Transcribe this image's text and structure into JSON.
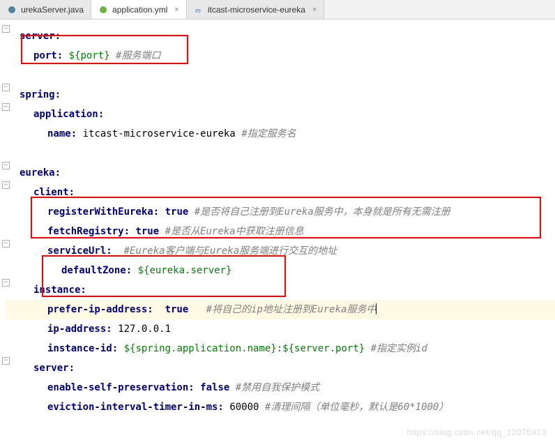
{
  "tabs": [
    {
      "label": "urekaServer.java",
      "icon": "java",
      "active": false,
      "closable": false
    },
    {
      "label": "application.yml",
      "icon": "spring",
      "active": true,
      "closable": true
    },
    {
      "label": "itcast-microservice-eureka",
      "icon": "maven",
      "active": false,
      "closable": true
    }
  ],
  "code": {
    "server": "server:",
    "port_key": "port:",
    "port_val": "${port}",
    "port_comment": "#服务端口",
    "spring": "spring:",
    "application": "application:",
    "name_key": "name:",
    "name_val": "itcast-microservice-eureka",
    "name_comment": "#指定服务名",
    "eureka": "eureka:",
    "client": "client:",
    "registerWithEureka_key": "registerWithEureka:",
    "registerWithEureka_val": "true",
    "registerWithEureka_comment": "#是否将自己注册到Eureka服务中，本身就是所有无需注册",
    "fetchRegistry_key": "fetchRegistry:",
    "fetchRegistry_val": "true",
    "fetchRegistry_comment": "#是否从Eureka中获取注册信息",
    "serviceUrl_key": "serviceUrl:",
    "serviceUrl_comment": "#Eureka客户端与Eureka服务端进行交互的地址",
    "defaultZone_key": "defaultZone:",
    "defaultZone_val": "${eureka.server}",
    "instance": "instance:",
    "preferIp_key": "prefer-ip-address:",
    "preferIp_val": "true",
    "preferIp_comment": "#将自己的ip地址注册到Eureka服务中",
    "ipAddress_key": "ip-address:",
    "ipAddress_val": "127.0.0.1",
    "instanceId_key": "instance-id:",
    "instanceId_val": "${spring.application.name}:${server.port}",
    "instanceId_comment": "#指定实例id",
    "server2": "server:",
    "enableSelfPres_key": "enable-self-preservation:",
    "enableSelfPres_val": "false",
    "enableSelfPres_comment": "#禁用自我保护模式",
    "eviction_key": "eviction-interval-timer-in-ms:",
    "eviction_val": "60000",
    "eviction_comment": "#清理间隔（单位毫秒，默认是60*1000）"
  },
  "watermark": "https://blog.csdn.net/qq_22075913"
}
